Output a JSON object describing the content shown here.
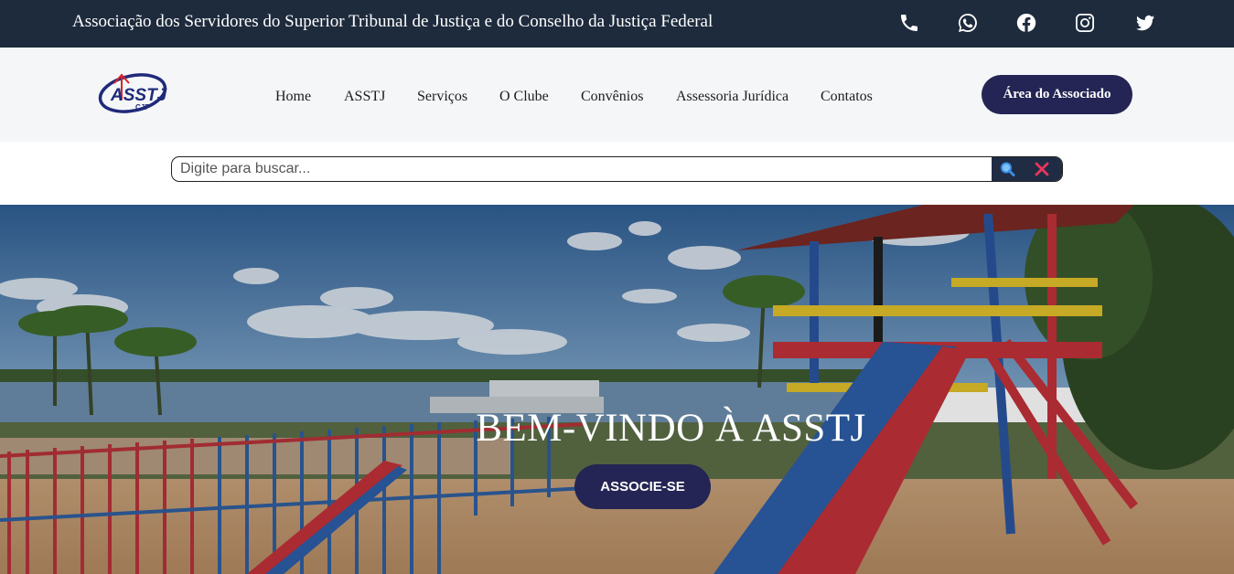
{
  "topbar": {
    "tagline": "Associação dos Servidores do Superior Tribunal de Justiça e do Conselho da Justiça Federal",
    "social_icons": [
      "phone-icon",
      "whatsapp-icon",
      "facebook-icon",
      "instagram-icon",
      "twitter-icon"
    ]
  },
  "logo": {
    "text": "ASSTJ",
    "subtext": "CJF"
  },
  "nav": {
    "items": [
      "Home",
      "ASSTJ",
      "Serviços",
      "O Clube",
      "Convênios",
      "Assessoria Jurídica",
      "Contatos"
    ],
    "member_button": "Área do Associado"
  },
  "search": {
    "placeholder": "Digite para buscar...",
    "value": ""
  },
  "hero": {
    "title": "BEM-VINDO À ASSTJ",
    "cta": "ASSOCIE-SE"
  },
  "colors": {
    "topbar": "#1e2b3d",
    "navbar": "#f5f6f8",
    "accent": "#242554",
    "clear_x": "#e8365d",
    "search_icon": "#3a8fe8"
  }
}
